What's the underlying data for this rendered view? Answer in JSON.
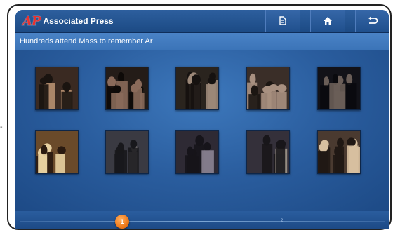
{
  "app": {
    "logo_text": "AP",
    "title": "Associated Press"
  },
  "toolbar": {
    "buttons": [
      {
        "name": "share-icon",
        "glyph": "✍"
      },
      {
        "name": "home-icon",
        "glyph": "⌂"
      },
      {
        "name": "back-icon",
        "glyph": "↶"
      }
    ]
  },
  "story": {
    "headline": "Hundreds attend Mass to remember Ar"
  },
  "gallery": {
    "thumbnails": [
      {
        "name": "photo-thumb-1",
        "palette": [
          "#3a2a22",
          "#b89070",
          "#1a1410"
        ]
      },
      {
        "name": "photo-thumb-2",
        "palette": [
          "#241c18",
          "#8a6a5a",
          "#0e0a08"
        ]
      },
      {
        "name": "photo-thumb-3",
        "palette": [
          "#2a241e",
          "#9c8878",
          "#161210"
        ]
      },
      {
        "name": "photo-thumb-4",
        "palette": [
          "#3a2e28",
          "#a89080",
          "#1c1612"
        ]
      },
      {
        "name": "photo-thumb-5",
        "palette": [
          "#121218",
          "#6a5e58",
          "#0a0a0e"
        ]
      },
      {
        "name": "photo-thumb-6",
        "palette": [
          "#6a4a2a",
          "#e8d0a0",
          "#2a1a10"
        ]
      },
      {
        "name": "photo-thumb-7",
        "palette": [
          "#3a3a42",
          "#b8b0b0",
          "#18181c"
        ]
      },
      {
        "name": "photo-thumb-8",
        "palette": [
          "#2e2a34",
          "#8c8494",
          "#16141a"
        ]
      },
      {
        "name": "photo-thumb-9",
        "palette": [
          "#34303a",
          "#a0988c",
          "#18161a"
        ]
      },
      {
        "name": "photo-thumb-10",
        "palette": [
          "#4a3a30",
          "#d8c0a0",
          "#201814"
        ]
      }
    ]
  },
  "pager": {
    "current_page": "1",
    "next_page": "2"
  },
  "side_mark": "-"
}
